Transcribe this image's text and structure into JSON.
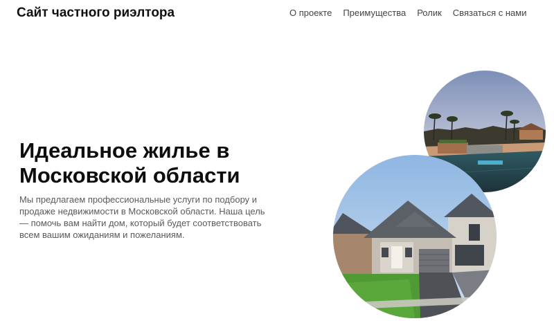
{
  "header": {
    "logo": "Сайт частного риэлтора",
    "nav": [
      {
        "label": "О проекте"
      },
      {
        "label": "Преимущества"
      },
      {
        "label": "Ролик"
      },
      {
        "label": "Связаться с нами"
      }
    ]
  },
  "hero": {
    "title": "Идеальное жилье в Московской области",
    "description": "Мы предлагаем профессиональные услуги по подбору и продаже недвижимости в Московской области. Наша цель — помочь вам найти дом, который будет соответствовать всем вашим ожиданиям и пожеланиям."
  },
  "images": {
    "pool": "pool-photo",
    "house": "house-photo"
  },
  "colors": {
    "text": "#111111",
    "nav": "#444444",
    "body_text": "#5a5a5a",
    "background": "#ffffff"
  }
}
